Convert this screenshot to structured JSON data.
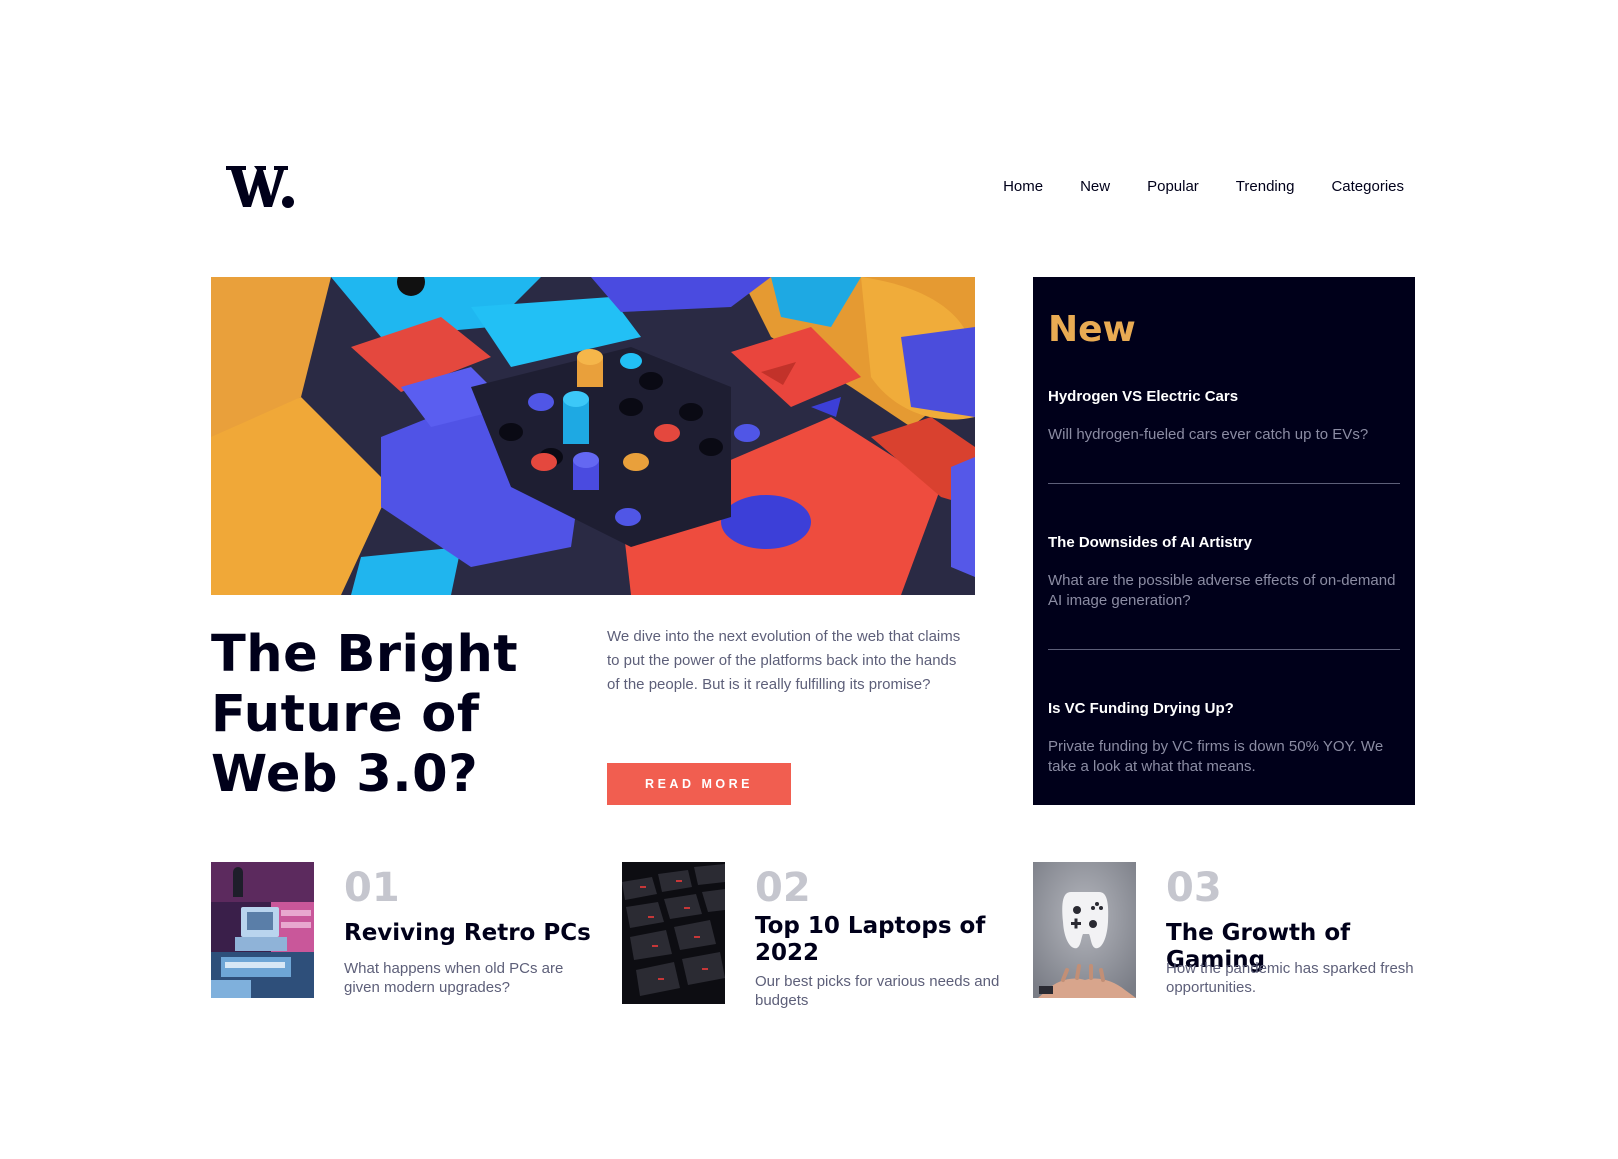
{
  "header": {
    "logo_text": "W.",
    "nav": [
      "Home",
      "New",
      "Popular",
      "Trending",
      "Categories"
    ]
  },
  "hero": {
    "title": "The Bright Future of Web 3.0?",
    "description": "We dive into the next evolution of the web that claims to put the power of the platforms back into the hands of the people. But is it really fulfilling its promise?",
    "button_label": "READ MORE"
  },
  "new_panel": {
    "heading": "New",
    "items": [
      {
        "title": "Hydrogen VS Electric Cars",
        "description": "Will hydrogen-fueled cars ever catch up to EVs?"
      },
      {
        "title": "The Downsides of AI Artistry",
        "description": "What are the possible adverse effects of on-demand AI image generation?"
      },
      {
        "title": "Is VC Funding Drying Up?",
        "description": "Private funding by VC firms is down 50% YOY. We take a look at what that means."
      }
    ]
  },
  "cards": [
    {
      "number": "01",
      "title": "Reviving Retro PCs",
      "description": "What happens when old PCs are given modern upgrades?",
      "image_icon": "retro-pc-image"
    },
    {
      "number": "02",
      "title": "Top 10 Laptops of 2022",
      "description": "Our best picks for various needs and budgets",
      "image_icon": "laptop-keyboard-image"
    },
    {
      "number": "03",
      "title": "The Growth of Gaming",
      "description": "How the pandemic has sparked fresh opportunities.",
      "image_icon": "game-controller-image"
    }
  ],
  "colors": {
    "accent_red": "#f15e50",
    "accent_orange": "#e9ab53",
    "dark_navy": "#00001a",
    "grayish_blue": "#5d5f79",
    "off_white": "#fffdfa"
  }
}
